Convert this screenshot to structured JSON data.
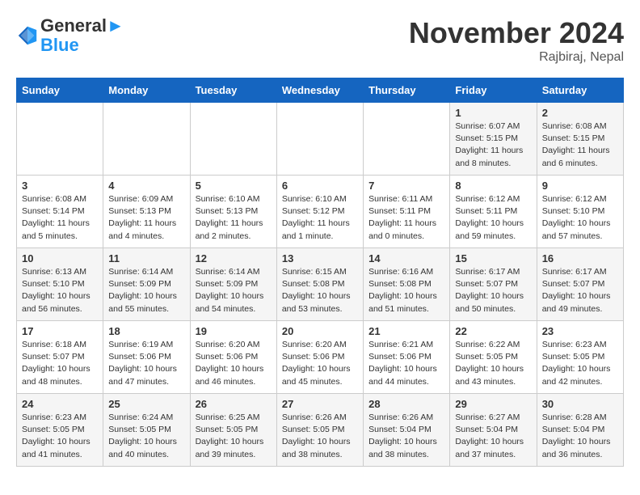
{
  "logo": {
    "line1": "General",
    "line2": "Blue"
  },
  "title": "November 2024",
  "location": "Rajbiraj, Nepal",
  "weekdays": [
    "Sunday",
    "Monday",
    "Tuesday",
    "Wednesday",
    "Thursday",
    "Friday",
    "Saturday"
  ],
  "rows": [
    [
      {
        "day": "",
        "info": ""
      },
      {
        "day": "",
        "info": ""
      },
      {
        "day": "",
        "info": ""
      },
      {
        "day": "",
        "info": ""
      },
      {
        "day": "",
        "info": ""
      },
      {
        "day": "1",
        "info": "Sunrise: 6:07 AM\nSunset: 5:15 PM\nDaylight: 11 hours and 8 minutes."
      },
      {
        "day": "2",
        "info": "Sunrise: 6:08 AM\nSunset: 5:15 PM\nDaylight: 11 hours and 6 minutes."
      }
    ],
    [
      {
        "day": "3",
        "info": "Sunrise: 6:08 AM\nSunset: 5:14 PM\nDaylight: 11 hours and 5 minutes."
      },
      {
        "day": "4",
        "info": "Sunrise: 6:09 AM\nSunset: 5:13 PM\nDaylight: 11 hours and 4 minutes."
      },
      {
        "day": "5",
        "info": "Sunrise: 6:10 AM\nSunset: 5:13 PM\nDaylight: 11 hours and 2 minutes."
      },
      {
        "day": "6",
        "info": "Sunrise: 6:10 AM\nSunset: 5:12 PM\nDaylight: 11 hours and 1 minute."
      },
      {
        "day": "7",
        "info": "Sunrise: 6:11 AM\nSunset: 5:11 PM\nDaylight: 11 hours and 0 minutes."
      },
      {
        "day": "8",
        "info": "Sunrise: 6:12 AM\nSunset: 5:11 PM\nDaylight: 10 hours and 59 minutes."
      },
      {
        "day": "9",
        "info": "Sunrise: 6:12 AM\nSunset: 5:10 PM\nDaylight: 10 hours and 57 minutes."
      }
    ],
    [
      {
        "day": "10",
        "info": "Sunrise: 6:13 AM\nSunset: 5:10 PM\nDaylight: 10 hours and 56 minutes."
      },
      {
        "day": "11",
        "info": "Sunrise: 6:14 AM\nSunset: 5:09 PM\nDaylight: 10 hours and 55 minutes."
      },
      {
        "day": "12",
        "info": "Sunrise: 6:14 AM\nSunset: 5:09 PM\nDaylight: 10 hours and 54 minutes."
      },
      {
        "day": "13",
        "info": "Sunrise: 6:15 AM\nSunset: 5:08 PM\nDaylight: 10 hours and 53 minutes."
      },
      {
        "day": "14",
        "info": "Sunrise: 6:16 AM\nSunset: 5:08 PM\nDaylight: 10 hours and 51 minutes."
      },
      {
        "day": "15",
        "info": "Sunrise: 6:17 AM\nSunset: 5:07 PM\nDaylight: 10 hours and 50 minutes."
      },
      {
        "day": "16",
        "info": "Sunrise: 6:17 AM\nSunset: 5:07 PM\nDaylight: 10 hours and 49 minutes."
      }
    ],
    [
      {
        "day": "17",
        "info": "Sunrise: 6:18 AM\nSunset: 5:07 PM\nDaylight: 10 hours and 48 minutes."
      },
      {
        "day": "18",
        "info": "Sunrise: 6:19 AM\nSunset: 5:06 PM\nDaylight: 10 hours and 47 minutes."
      },
      {
        "day": "19",
        "info": "Sunrise: 6:20 AM\nSunset: 5:06 PM\nDaylight: 10 hours and 46 minutes."
      },
      {
        "day": "20",
        "info": "Sunrise: 6:20 AM\nSunset: 5:06 PM\nDaylight: 10 hours and 45 minutes."
      },
      {
        "day": "21",
        "info": "Sunrise: 6:21 AM\nSunset: 5:06 PM\nDaylight: 10 hours and 44 minutes."
      },
      {
        "day": "22",
        "info": "Sunrise: 6:22 AM\nSunset: 5:05 PM\nDaylight: 10 hours and 43 minutes."
      },
      {
        "day": "23",
        "info": "Sunrise: 6:23 AM\nSunset: 5:05 PM\nDaylight: 10 hours and 42 minutes."
      }
    ],
    [
      {
        "day": "24",
        "info": "Sunrise: 6:23 AM\nSunset: 5:05 PM\nDaylight: 10 hours and 41 minutes."
      },
      {
        "day": "25",
        "info": "Sunrise: 6:24 AM\nSunset: 5:05 PM\nDaylight: 10 hours and 40 minutes."
      },
      {
        "day": "26",
        "info": "Sunrise: 6:25 AM\nSunset: 5:05 PM\nDaylight: 10 hours and 39 minutes."
      },
      {
        "day": "27",
        "info": "Sunrise: 6:26 AM\nSunset: 5:05 PM\nDaylight: 10 hours and 38 minutes."
      },
      {
        "day": "28",
        "info": "Sunrise: 6:26 AM\nSunset: 5:04 PM\nDaylight: 10 hours and 38 minutes."
      },
      {
        "day": "29",
        "info": "Sunrise: 6:27 AM\nSunset: 5:04 PM\nDaylight: 10 hours and 37 minutes."
      },
      {
        "day": "30",
        "info": "Sunrise: 6:28 AM\nSunset: 5:04 PM\nDaylight: 10 hours and 36 minutes."
      }
    ]
  ]
}
